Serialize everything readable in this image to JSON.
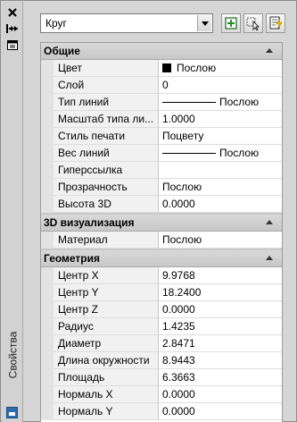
{
  "panel": {
    "vertical_title": "Свойства"
  },
  "toolbar": {
    "object_selector": "Круг",
    "buttons": [
      "toggle-pickadd-icon",
      "select-objects-icon",
      "quick-select-icon"
    ]
  },
  "categories": [
    {
      "label": "Общие",
      "rows": [
        {
          "name": "Цвет",
          "value": "Послою",
          "kind": "color"
        },
        {
          "name": "Слой",
          "value": "0"
        },
        {
          "name": "Тип линий",
          "value": "Послою",
          "kind": "line"
        },
        {
          "name": "Масштаб типа ли...",
          "value": "1.0000"
        },
        {
          "name": "Стиль печати",
          "value": "Поцвету"
        },
        {
          "name": "Вес линий",
          "value": "Послою",
          "kind": "line"
        },
        {
          "name": "Гиперссылка",
          "value": ""
        },
        {
          "name": "Прозрачность",
          "value": "Послою"
        },
        {
          "name": "Высота 3D",
          "value": "0.0000"
        }
      ]
    },
    {
      "label": "3D визуализация",
      "rows": [
        {
          "name": "Материал",
          "value": "Послою"
        }
      ]
    },
    {
      "label": "Геометрия",
      "rows": [
        {
          "name": "Центр X",
          "value": "9.9768"
        },
        {
          "name": "Центр Y",
          "value": "18.2400"
        },
        {
          "name": "Центр Z",
          "value": "0.0000"
        },
        {
          "name": "Радиус",
          "value": "1.4235"
        },
        {
          "name": "Диаметр",
          "value": "2.8471"
        },
        {
          "name": "Длина окружности",
          "value": "8.9443"
        },
        {
          "name": "Площадь",
          "value": "6.3663"
        },
        {
          "name": "Нормаль X",
          "value": "0.0000"
        },
        {
          "name": "Нормаль Y",
          "value": "0.0000"
        }
      ]
    }
  ]
}
